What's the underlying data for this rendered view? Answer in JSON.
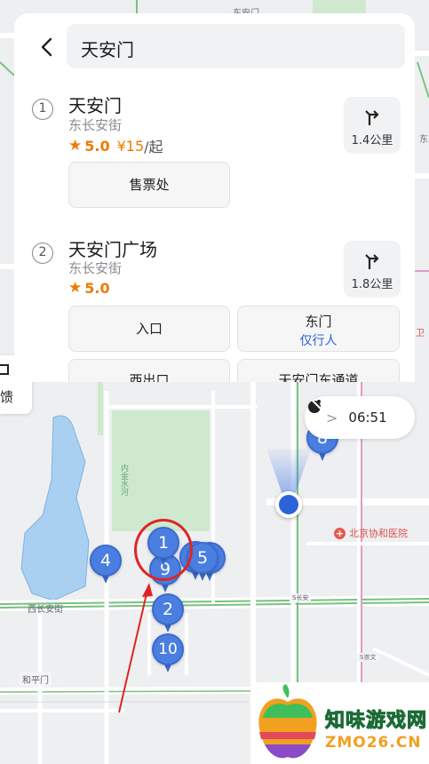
{
  "search": {
    "query": "天安门"
  },
  "results": [
    {
      "index": "1",
      "name": "天安门",
      "address": "东长安街",
      "rating": "5.0",
      "price": "¥15",
      "price_suffix": "/起",
      "distance": "1.4公里",
      "sub_buttons": [
        {
          "label": "售票处"
        }
      ]
    },
    {
      "index": "2",
      "name": "天安门广场",
      "address": "东长安街",
      "rating": "5.0",
      "distance": "1.8公里",
      "sub_buttons": [
        {
          "label": "入口"
        },
        {
          "label": "东门",
          "note": "仅行人"
        },
        {
          "label": "西出口"
        },
        {
          "label": "天安门东通道"
        }
      ]
    }
  ],
  "map": {
    "time": "06:51",
    "hospital": "北京协和医院",
    "road_west_changan": "西长安街",
    "station_hepingmen": "和平门",
    "top_label": "东安门",
    "park_label": "内金水河",
    "right_label_1": "东",
    "right_label_2": "卫",
    "left_tab_text": "馈",
    "road_tag_1": "S长安",
    "road_tag_2": "S崇文",
    "pins": [
      "1",
      "9",
      "5",
      "4",
      "2",
      "10",
      "8"
    ]
  },
  "watermark": {
    "line1": "知味游戏网",
    "line2": "ZMO26.CN"
  },
  "colors": {
    "accent": "#2d63d8",
    "pin": "#4a7ee0",
    "rating": "#f07a00",
    "annotation": "#e02424"
  }
}
